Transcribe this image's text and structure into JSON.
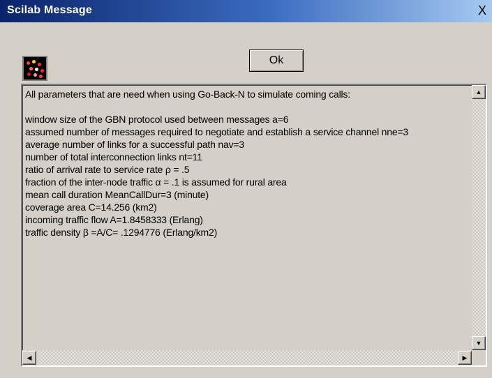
{
  "window": {
    "title": "Scilab Message",
    "close_label": "X"
  },
  "icons": {
    "app": "scilab-logo-icon",
    "close": "close-icon",
    "scroll_up": "arrow-up-icon",
    "scroll_down": "arrow-down-icon",
    "scroll_left": "arrow-left-icon",
    "scroll_right": "arrow-right-icon"
  },
  "buttons": {
    "ok_label": "Ok"
  },
  "message": {
    "lines": [
      "All parameters that are need when using Go-Back-N to simulate coming calls:",
      "",
      "window size of the GBN protocol used between messages  a=6",
      "assumed number of messages required to negotiate and establish a service channel  nne=3",
      "average number of links for a successful path  nav=3",
      "number of total interconnection links  nt=11",
      "ratio of arrival rate to service rate  ρ = .5",
      "fraction of the inter-node traffic  α = .1  is assumed for rural area",
      "mean call duration  MeanCallDur=3 (minute)",
      "coverage area  C=14.256 (km2)",
      "incoming traffic flow  A=1.8458333 (Erlang)",
      "traffic density  β =A/C= .1294776 (Erlang/km2)"
    ]
  },
  "colors": {
    "titlebar_start": "#0a246a",
    "titlebar_end": "#a6caf0",
    "dialog_bg": "#d4d0c8"
  }
}
